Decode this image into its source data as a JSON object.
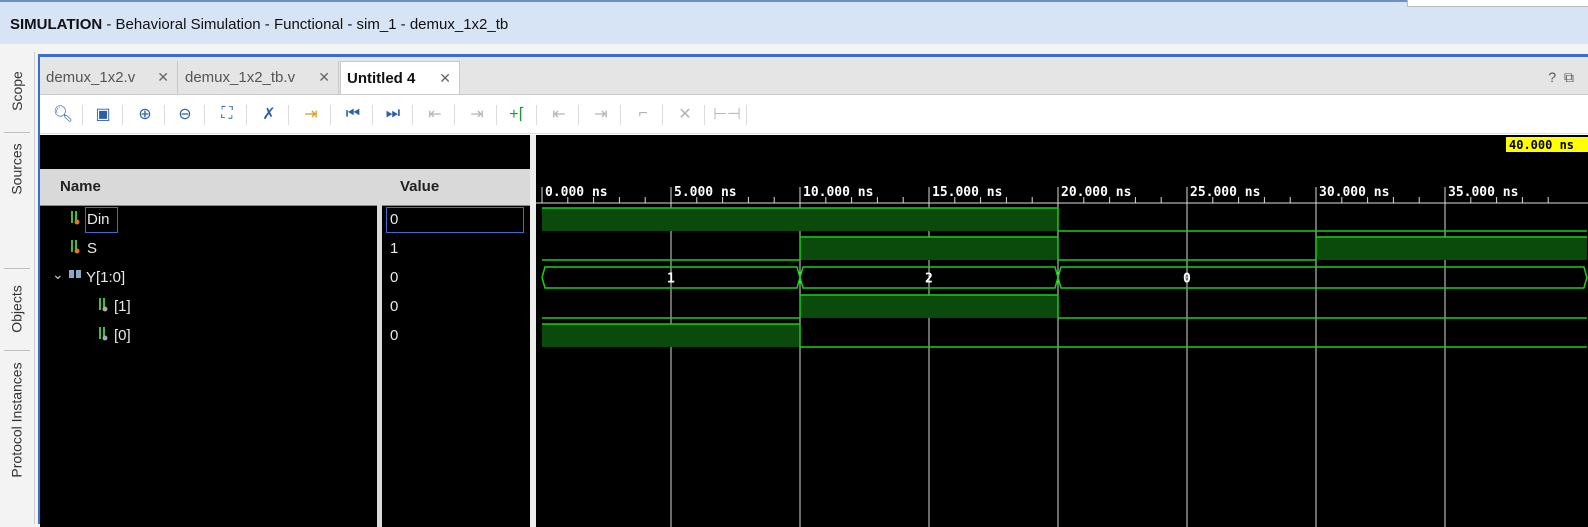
{
  "titlebar": {
    "mode": "SIMULATION",
    "rest": " - Behavioral Simulation - Functional - sim_1 - demux_1x2_tb"
  },
  "side_tabs": [
    "Scope",
    "Sources",
    "Objects",
    "Protocol Instances"
  ],
  "file_tabs": [
    {
      "label": "demux_1x2.v",
      "active": false
    },
    {
      "label": "demux_1x2_tb.v",
      "active": false
    },
    {
      "label": "Untitled 4",
      "active": true
    }
  ],
  "window_controls": {
    "help": "?",
    "restore": "⧉"
  },
  "toolbar_icons": [
    "search-icon",
    "save-icon",
    "zoom-in-icon",
    "zoom-out-icon",
    "zoom-fit-icon",
    "snap-cursor-icon",
    "go-to-cursor-icon",
    "go-to-start-icon",
    "go-to-end-icon",
    "previous-transition-icon",
    "next-transition-icon",
    "add-marker-icon",
    "previous-marker-icon",
    "next-marker-icon",
    "swap-cursors-icon",
    "delete-marker-icon",
    "cursor-delta-icon"
  ],
  "columns": {
    "name": "Name",
    "value": "Value"
  },
  "signals": [
    {
      "name": "Din",
      "value": "0"
    },
    {
      "name": "S",
      "value": "1"
    },
    {
      "name": "Y[1:0]",
      "value": "0"
    },
    {
      "name": "[1]",
      "value": "0"
    },
    {
      "name": "[0]",
      "value": "0"
    }
  ],
  "cursor_time": "40.000 ns",
  "waveform": {
    "time_labels": [
      "0.000 ns",
      "5.000 ns",
      "10.000 ns",
      "15.000 ns",
      "20.000 ns",
      "25.000 ns",
      "30.000 ns",
      "35.000 ns"
    ],
    "time_range_ns": [
      0,
      40
    ],
    "Din": [
      [
        0,
        1
      ],
      [
        20,
        0
      ]
    ],
    "S": [
      [
        0,
        0
      ],
      [
        10,
        1
      ],
      [
        20,
        0
      ],
      [
        30,
        1
      ]
    ],
    "Y": [
      [
        0,
        "1"
      ],
      [
        10,
        "2"
      ],
      [
        20,
        "0"
      ]
    ],
    "Y1": [
      [
        0,
        0
      ],
      [
        10,
        1
      ],
      [
        20,
        0
      ]
    ],
    "Y0": [
      [
        0,
        1
      ],
      [
        10,
        0
      ]
    ]
  },
  "colors": {
    "wave": "#18d018",
    "fill": "#0a4a0a",
    "cursor_bg": "#ffff00",
    "accent": "#3a6ed0"
  }
}
